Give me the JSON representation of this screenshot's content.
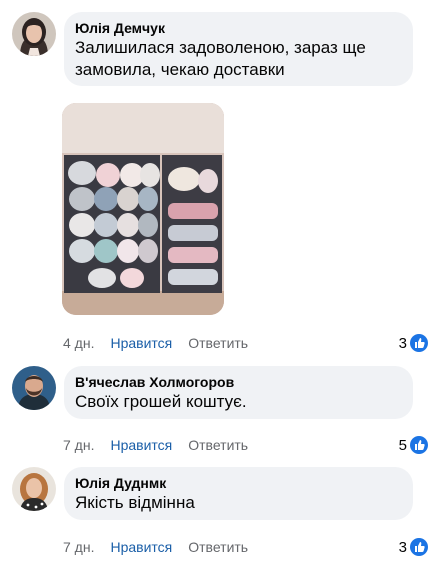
{
  "comments": [
    {
      "author": "Юлія Демчук",
      "text_lines": [
        "Залишилася задоволеною, зараз ще",
        "замовила, чекаю доставки"
      ],
      "time": "4 дн.",
      "like_label": "Нравится",
      "reply_label": "Ответить",
      "reactions": "3",
      "reaction_icon": "thumbs-up-icon",
      "avatar_icon": "avatar-woman-dark-hair"
    },
    {
      "author": "В'ячеслав Холмогоров",
      "text_lines": [
        "Своїх грошей коштує."
      ],
      "time": "7 дн.",
      "like_label": "Нравится",
      "reply_label": "Ответить",
      "reactions": "5",
      "reaction_icon": "thumbs-up-icon",
      "avatar_icon": "avatar-man-beard"
    },
    {
      "author": "Юлія Дуднмк",
      "text_lines": [
        "Якість відмінна"
      ],
      "time": "7 дн.",
      "like_label": "Нравится",
      "reply_label": "Ответить",
      "reactions": "3",
      "reaction_icon": "thumbs-up-icon",
      "avatar_icon": "avatar-woman-light-hair"
    }
  ],
  "colors": {
    "bubble": "#f0f2f5",
    "like_link": "#1b5fa8",
    "meta_text": "#65676b",
    "reaction_blue": "#1b74e4"
  }
}
